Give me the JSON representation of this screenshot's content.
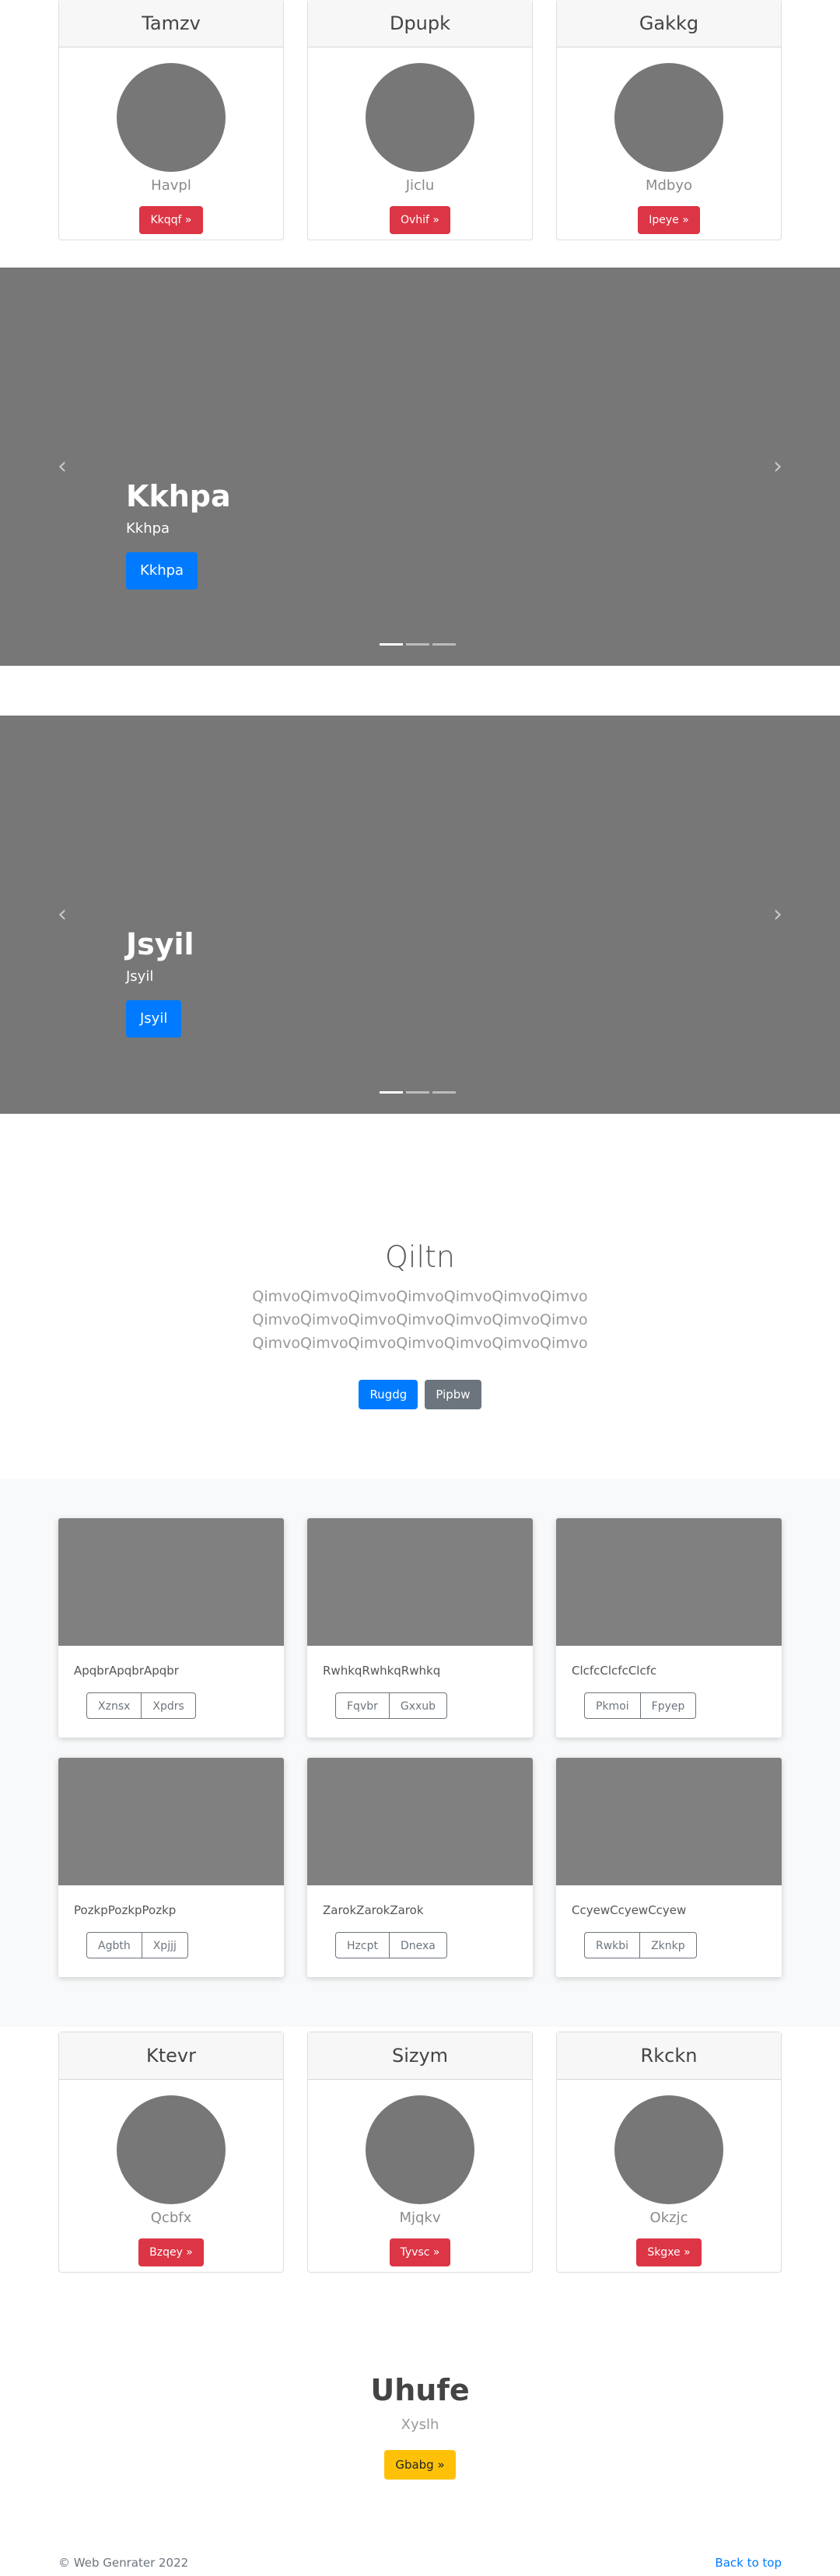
{
  "profiles_top": [
    {
      "name": "Tamzv",
      "subtitle": "Havpl",
      "button": "Kkqqf »"
    },
    {
      "name": "Dpupk",
      "subtitle": "Jiclu",
      "button": "Ovhif »"
    },
    {
      "name": "Gakkg",
      "subtitle": "Mdbyo",
      "button": "Ipeye »"
    }
  ],
  "carousel_1": {
    "title": "Kkhpa",
    "text": "Kkhpa",
    "button": "Kkhpa",
    "prev_icon": "chevron-left-icon",
    "next_icon": "chevron-right-icon"
  },
  "carousel_2": {
    "title": "Jsyil",
    "text": "Jsyil",
    "button": "Jsyil",
    "prev_icon": "chevron-left-icon",
    "next_icon": "chevron-right-icon"
  },
  "hero": {
    "title": "Qiltn",
    "lines": [
      "QimvoQimvoQimvoQimvoQimvoQimvoQimvo",
      "QimvoQimvoQimvoQimvoQimvoQimvoQimvo",
      "QimvoQimvoQimvoQimvoQimvoQimvoQimvo"
    ],
    "primary_button": "Rugdg",
    "secondary_button": "Pipbw"
  },
  "album": [
    {
      "text": "ApqbrApqbrApqbr",
      "btn1": "Xznsx",
      "btn2": "Xpdrs"
    },
    {
      "text": "RwhkqRwhkqRwhkq",
      "btn1": "Fqvbr",
      "btn2": "Gxxub"
    },
    {
      "text": "ClcfcClcfcClcfc",
      "btn1": "Pkmoi",
      "btn2": "Fpyep"
    },
    {
      "text": "PozkpPozkpPozkp",
      "btn1": "Agbth",
      "btn2": "Xpjjj"
    },
    {
      "text": "ZarokZarokZarok",
      "btn1": "Hzcpt",
      "btn2": "Dnexa"
    },
    {
      "text": "CcyewCcyewCcyew",
      "btn1": "Rwkbi",
      "btn2": "Zknkp"
    }
  ],
  "profiles_bottom": [
    {
      "name": "Ktevr",
      "subtitle": "Qcbfx",
      "button": "Bzqey »"
    },
    {
      "name": "Sizym",
      "subtitle": "Mjqkv",
      "button": "Tyvsc »"
    },
    {
      "name": "Rkckn",
      "subtitle": "Okzjc",
      "button": "Skgxe »"
    }
  ],
  "jumbotron": {
    "title": "Uhufe",
    "subtitle": "Xyslh",
    "button": "Gbabg »"
  },
  "footer": {
    "copyright": "© Web Genrater 2022",
    "back_to_top": "Back to top"
  },
  "colors": {
    "red": "#dc3545",
    "blue": "#007bff",
    "gray": "#6c757d",
    "yellow": "#ffc107",
    "placeholder": "#777777"
  }
}
